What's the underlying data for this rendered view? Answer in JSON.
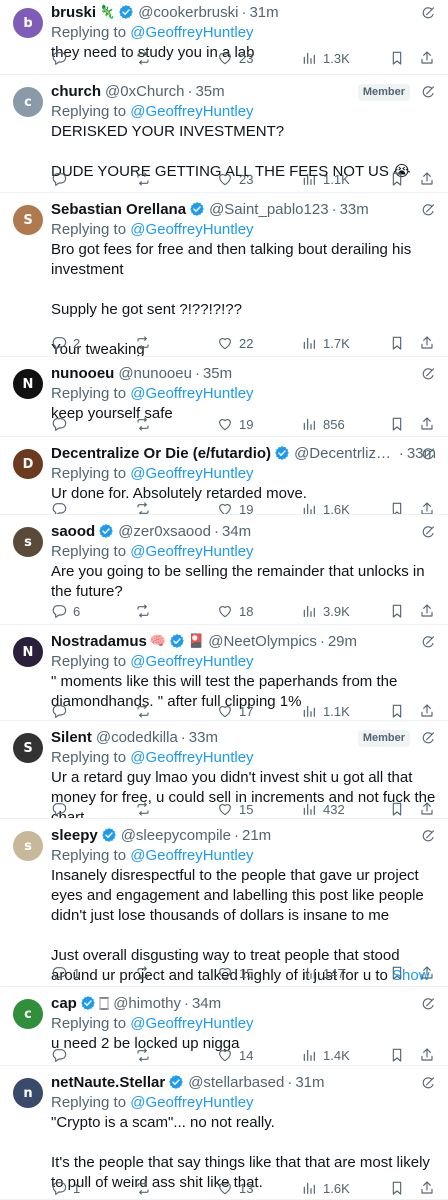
{
  "ui": {
    "replying_label": "Replying to",
    "mention": "@GeoffreyHuntley",
    "show_more": "Show more",
    "member_label": "Member",
    "colors": {
      "accent": "#1d9bf0",
      "secondary": "#536471",
      "verified": "#1d9bf0",
      "border": "#eff3f4"
    }
  },
  "replies": [
    {
      "name": "bruski",
      "name_emoji": "🦎",
      "verified": true,
      "handle": "@cookerbruski",
      "time": "31m",
      "member": false,
      "text": [
        "they need to study you in a lab"
      ],
      "counts": {
        "replies": "",
        "reposts": "",
        "likes": "23",
        "views": "1.3K"
      },
      "avatar_color": "#7e5cb8",
      "avatar_glyph": "b"
    },
    {
      "name": "church",
      "verified": false,
      "handle": "@0xChurch",
      "time": "35m",
      "member": true,
      "text": [
        "DERISKED YOUR INVESTMENT?",
        "",
        "DUDE YOURE GETTING ALL THE FEES NOT US 😭"
      ],
      "counts": {
        "replies": "",
        "reposts": "",
        "likes": "23",
        "views": "1.1K"
      },
      "avatar_color": "#8a9aa8",
      "avatar_glyph": "c"
    },
    {
      "name": "Sebastian Orellana",
      "verified": true,
      "handle": "@Saint_pablo123",
      "time": "33m",
      "member": false,
      "text": [
        "Bro got fees for free and then talking bout derailing his investment",
        "",
        "Supply he got sent ?!??!?!??",
        "",
        "Your tweaking"
      ],
      "counts": {
        "replies": "2",
        "reposts": "",
        "likes": "22",
        "views": "1.7K"
      },
      "avatar_color": "#b07a4f",
      "avatar_glyph": "S"
    },
    {
      "name": "nunooeu",
      "verified": false,
      "handle": "@nunooeu",
      "time": "35m",
      "member": false,
      "text": [
        "keep yourself safe"
      ],
      "counts": {
        "replies": "",
        "reposts": "",
        "likes": "19",
        "views": "856"
      },
      "avatar_color": "#111111",
      "avatar_glyph": "N"
    },
    {
      "name": "Decentralize Or Die (e/futardio)",
      "verified": true,
      "handle": "@DecentrlizOr...",
      "time": "33m",
      "member": false,
      "text": [
        "Ur done for. Absolutely retarded move."
      ],
      "counts": {
        "replies": "",
        "reposts": "",
        "likes": "19",
        "views": "1.6K"
      },
      "avatar_color": "#6b3a1f",
      "avatar_glyph": "D"
    },
    {
      "name": "saood",
      "verified": true,
      "handle": "@zer0xsaood",
      "time": "34m",
      "member": false,
      "text": [
        "Are you going to be selling the remainder that unlocks in the future?"
      ],
      "counts": {
        "replies": "6",
        "reposts": "",
        "likes": "18",
        "views": "3.9K"
      },
      "avatar_color": "#5a4a3a",
      "avatar_glyph": "s"
    },
    {
      "name": "Nostradamus",
      "name_emoji": "🧠",
      "verified": true,
      "extra_emoji": "🎴",
      "handle": "@NeetOlympics",
      "time": "29m",
      "member": false,
      "text": [
        "\" moments like this will test the paperhands from the diamondhands. \" after full clipping 1%"
      ],
      "counts": {
        "replies": "",
        "reposts": "",
        "likes": "17",
        "views": "1.1K"
      },
      "avatar_color": "#2a1f3d",
      "avatar_glyph": "N"
    },
    {
      "name": "Silent",
      "verified": false,
      "handle": "@codedkilla",
      "time": "33m",
      "member": true,
      "text": [
        "Ur a retard guy lmao you didn't invest shit u got all that money for free, u could sell in increments and not fuck the chart"
      ],
      "counts": {
        "replies": "",
        "reposts": "",
        "likes": "15",
        "views": "432"
      },
      "avatar_color": "#333333",
      "avatar_glyph": "S"
    },
    {
      "name": "sleepy",
      "verified": true,
      "handle": "@sleepycompile",
      "time": "21m",
      "member": false,
      "text": [
        "Insanely disrespectful to the people that gave ur project eyes and engagement and labelling this post like people didn't just lose thousands of dollars is insane to me",
        "",
        "Just overall disgusting way to treat people that stood around ur project and talked highly of it just for u to"
      ],
      "show_more": true,
      "counts": {
        "replies": "1",
        "reposts": "",
        "likes": "15",
        "views": "147"
      },
      "avatar_color": "#c8b89a",
      "avatar_glyph": "s"
    },
    {
      "name": "cap",
      "verified": true,
      "extra_emoji": "🀆",
      "handle": "@himothy",
      "time": "34m",
      "member": false,
      "text": [
        "u need 2 be locked up nigga"
      ],
      "counts": {
        "replies": "",
        "reposts": "",
        "likes": "14",
        "views": "1.4K"
      },
      "avatar_color": "#2f8f3a",
      "avatar_glyph": "c"
    },
    {
      "name": "netNaute.Stellar",
      "verified": true,
      "handle": "@stellarbased",
      "time": "31m",
      "member": false,
      "text": [
        "\"Crypto is a scam\"... no not really.",
        "",
        "It's the people that say things like that that are most likely to pull of weird ass shit like that."
      ],
      "counts": {
        "replies": "1",
        "reposts": "",
        "likes": "13",
        "views": "1.6K"
      },
      "avatar_color": "#3a4a6a",
      "avatar_glyph": "n"
    }
  ]
}
